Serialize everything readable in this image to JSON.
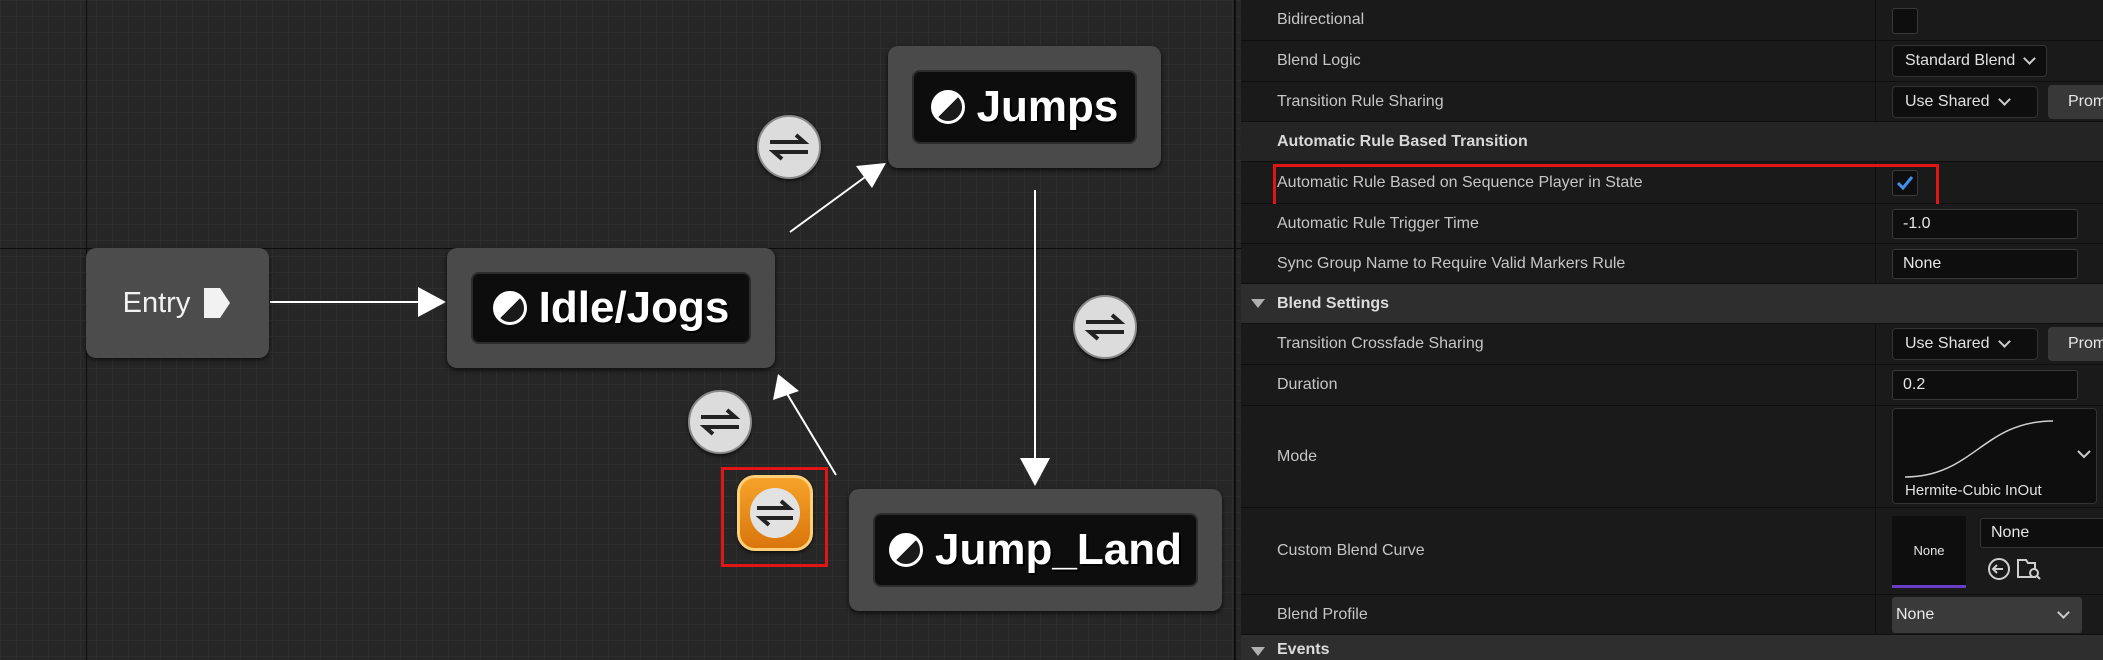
{
  "graph": {
    "entry_label": "Entry",
    "states": {
      "jumps": "Jumps",
      "idle": "Idle/Jogs",
      "jump_land": "Jump_Land"
    }
  },
  "details": {
    "bidirectional_label": "Bidirectional",
    "blend_logic_label": "Blend Logic",
    "blend_logic_value": "Standard Blend",
    "rule_sharing_label": "Transition Rule Sharing",
    "rule_sharing_value": "Use Shared",
    "promote_label": "Prom",
    "auto_section_title": "Automatic Rule Based Transition",
    "auto_rule_label": "Automatic Rule Based on Sequence Player in State",
    "auto_rule_checked": true,
    "trigger_time_label": "Automatic Rule Trigger Time",
    "trigger_time_value": "-1.0",
    "sync_group_label": "Sync Group Name to Require Valid Markers Rule",
    "sync_group_value": "None",
    "blend_settings_title": "Blend Settings",
    "crossfade_sharing_label": "Transition Crossfade Sharing",
    "crossfade_sharing_value": "Use Shared",
    "crossfade_promote_label": "Prom",
    "duration_label": "Duration",
    "duration_value": "0.2",
    "mode_label": "Mode",
    "mode_value": "Hermite-Cubic InOut",
    "custom_curve_label": "Custom Blend Curve",
    "custom_curve_thumb": "None",
    "custom_curve_value": "None",
    "blend_profile_label": "Blend Profile",
    "blend_profile_value": "None",
    "events_title": "Events"
  },
  "colors": {
    "highlight": "#e01616",
    "selected_transition": "#f2a024",
    "checkbox_check": "#3f8ff0"
  }
}
